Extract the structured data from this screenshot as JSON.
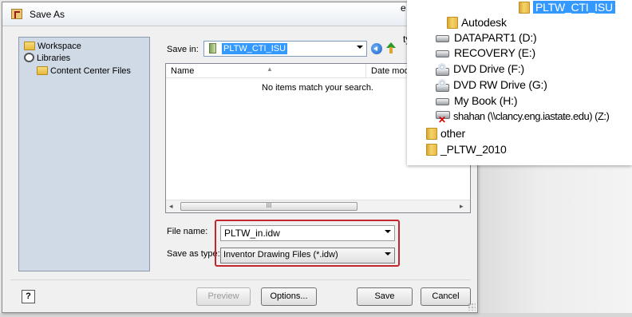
{
  "window": {
    "title": "Save As"
  },
  "places": [
    {
      "label": "Workspace",
      "icon": "folder-icon"
    },
    {
      "label": "Libraries",
      "icon": "libraries-icon"
    },
    {
      "label": "Content Center Files",
      "icon": "folder-icon"
    }
  ],
  "save_in": {
    "label": "Save in:",
    "value": "PLTW_CTI_ISU"
  },
  "file_list": {
    "columns": [
      "Name",
      "Date mod..."
    ],
    "empty_message": "No items match your search.",
    "scroll_thumb": "III"
  },
  "file_name": {
    "label": "File name:",
    "value": "PLTW_in.idw"
  },
  "save_as_type": {
    "label": "Save as type:",
    "value": "Inventor Drawing Files (*.idw)"
  },
  "buttons": {
    "help": "?",
    "preview": "Preview",
    "options": "Options...",
    "save": "Save",
    "cancel": "Cancel"
  },
  "partial_texts": {
    "clipped_e": "e",
    "clipped_ty": "ty"
  },
  "tree": {
    "items": [
      {
        "label": "PLTW_CTI_ISU",
        "icon": "folder-icon",
        "selected": true
      },
      {
        "label": "Autodesk",
        "icon": "folder-icon"
      },
      {
        "label": "DATAPART1 (D:)",
        "icon": "drive-icon"
      },
      {
        "label": "RECOVERY (E:)",
        "icon": "drive-icon"
      },
      {
        "label": "DVD Drive (F:)",
        "icon": "dvd-drive-icon"
      },
      {
        "label": "DVD RW Drive (G:)",
        "icon": "dvd-drive-icon"
      },
      {
        "label": "My Book (H:)",
        "icon": "drive-icon"
      },
      {
        "label": "shahan (\\\\clancy.eng.iastate.edu) (Z:)",
        "icon": "disconnected-network-drive-icon"
      },
      {
        "label": "other",
        "icon": "folder-icon"
      },
      {
        "label": "_PLTW_2010",
        "icon": "folder-icon"
      }
    ]
  },
  "colors": {
    "selection": "#3399ff",
    "highlight_box": "#c0282d",
    "places_bg": "#cfdae6"
  }
}
